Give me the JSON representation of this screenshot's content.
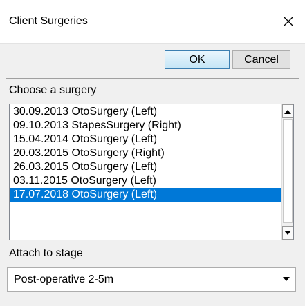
{
  "window": {
    "title": "Client Surgeries",
    "close_glyph": "✕"
  },
  "toolbar": {
    "ok_mnemonic": "O",
    "ok_rest": "K",
    "cancel_mnemonic": "C",
    "cancel_rest": "ancel"
  },
  "surgery_section": {
    "label": "Choose a surgery",
    "items": [
      "30.09.2013 OtoSurgery (Left)",
      "09.10.2013 StapesSurgery (Right)",
      "15.04.2014 OtoSurgery (Left)",
      "20.03.2015 OtoSurgery (Right)",
      "26.03.2015 OtoSurgery (Left)",
      "03.11.2015 OtoSurgery (Left)",
      "17.07.2018 OtoSurgery (Left)"
    ],
    "selected_index": 6
  },
  "stage_section": {
    "label": "Attach to stage",
    "selected_value": "Post-operative 2-5m"
  },
  "colors": {
    "selection": "#0078d7",
    "dialog_bg": "#f0f0f0",
    "ok_border": "#3c7fb1"
  }
}
